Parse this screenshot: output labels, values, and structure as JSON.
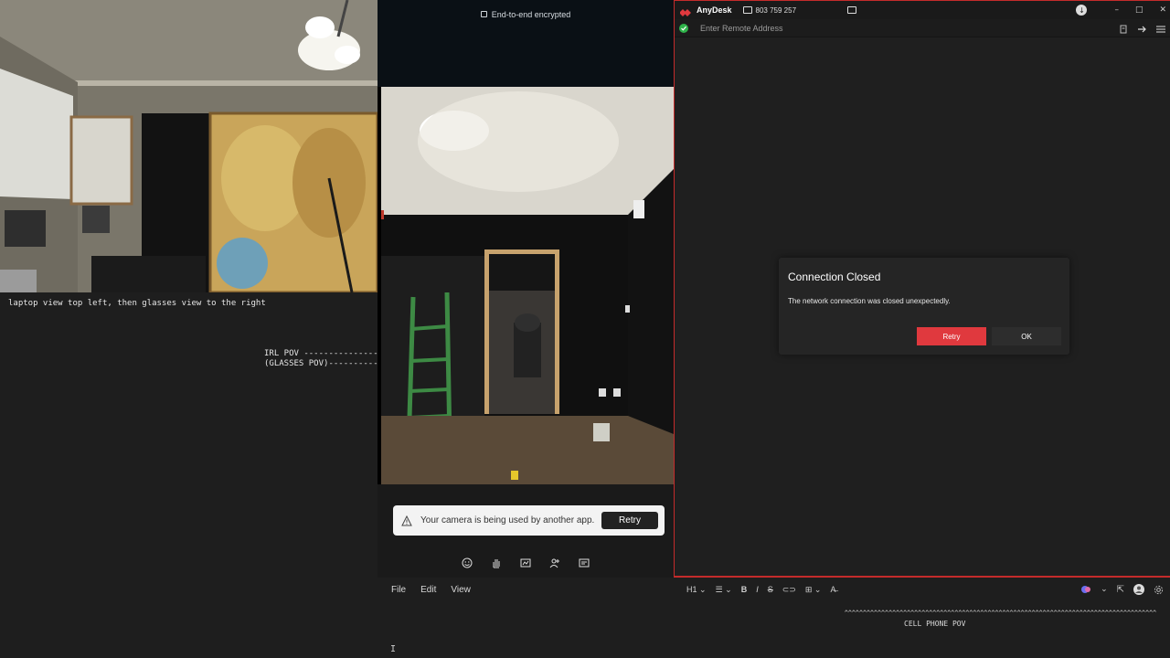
{
  "notes": {
    "line1": "laptop view top left, then glasses view to the right",
    "line2": "IRL POV --------------->",
    "line3": "(GLASSES POV)---------->"
  },
  "call": {
    "encrypted_label": "End-to-end encrypted",
    "toast_message": "Your camera is being used by another app.",
    "toast_retry": "Retry",
    "controls": [
      "emoji-icon",
      "raise-hand-icon",
      "share-screen-icon",
      "add-people-icon",
      "more-icon"
    ]
  },
  "anydesk": {
    "app_name": "AnyDesk",
    "id": "803 759 257",
    "address_placeholder": "Enter Remote Address",
    "dialog": {
      "title": "Connection Closed",
      "message": "The network connection was closed unexpectedly.",
      "retry": "Retry",
      "ok": "OK"
    },
    "colors": {
      "accent": "#e0393e",
      "status": "#2fb34a",
      "frame": "#c42b2b"
    }
  },
  "editor": {
    "menu": [
      "File",
      "Edit",
      "View"
    ],
    "toolbar": {
      "heading": "H1",
      "bold": "B",
      "italic": "I",
      "strike": "S"
    },
    "text_line1": "^^^^^^^^^^^^^^^^^^^^^^^^^^^^^^^^^^^^^^^^^^^^^^^^^^^^^^^^^^^^^^^^^^^^^^^^^^^^^^^^^^^^^",
    "text_line2": "CELL PHONE POV",
    "caret": "I"
  }
}
